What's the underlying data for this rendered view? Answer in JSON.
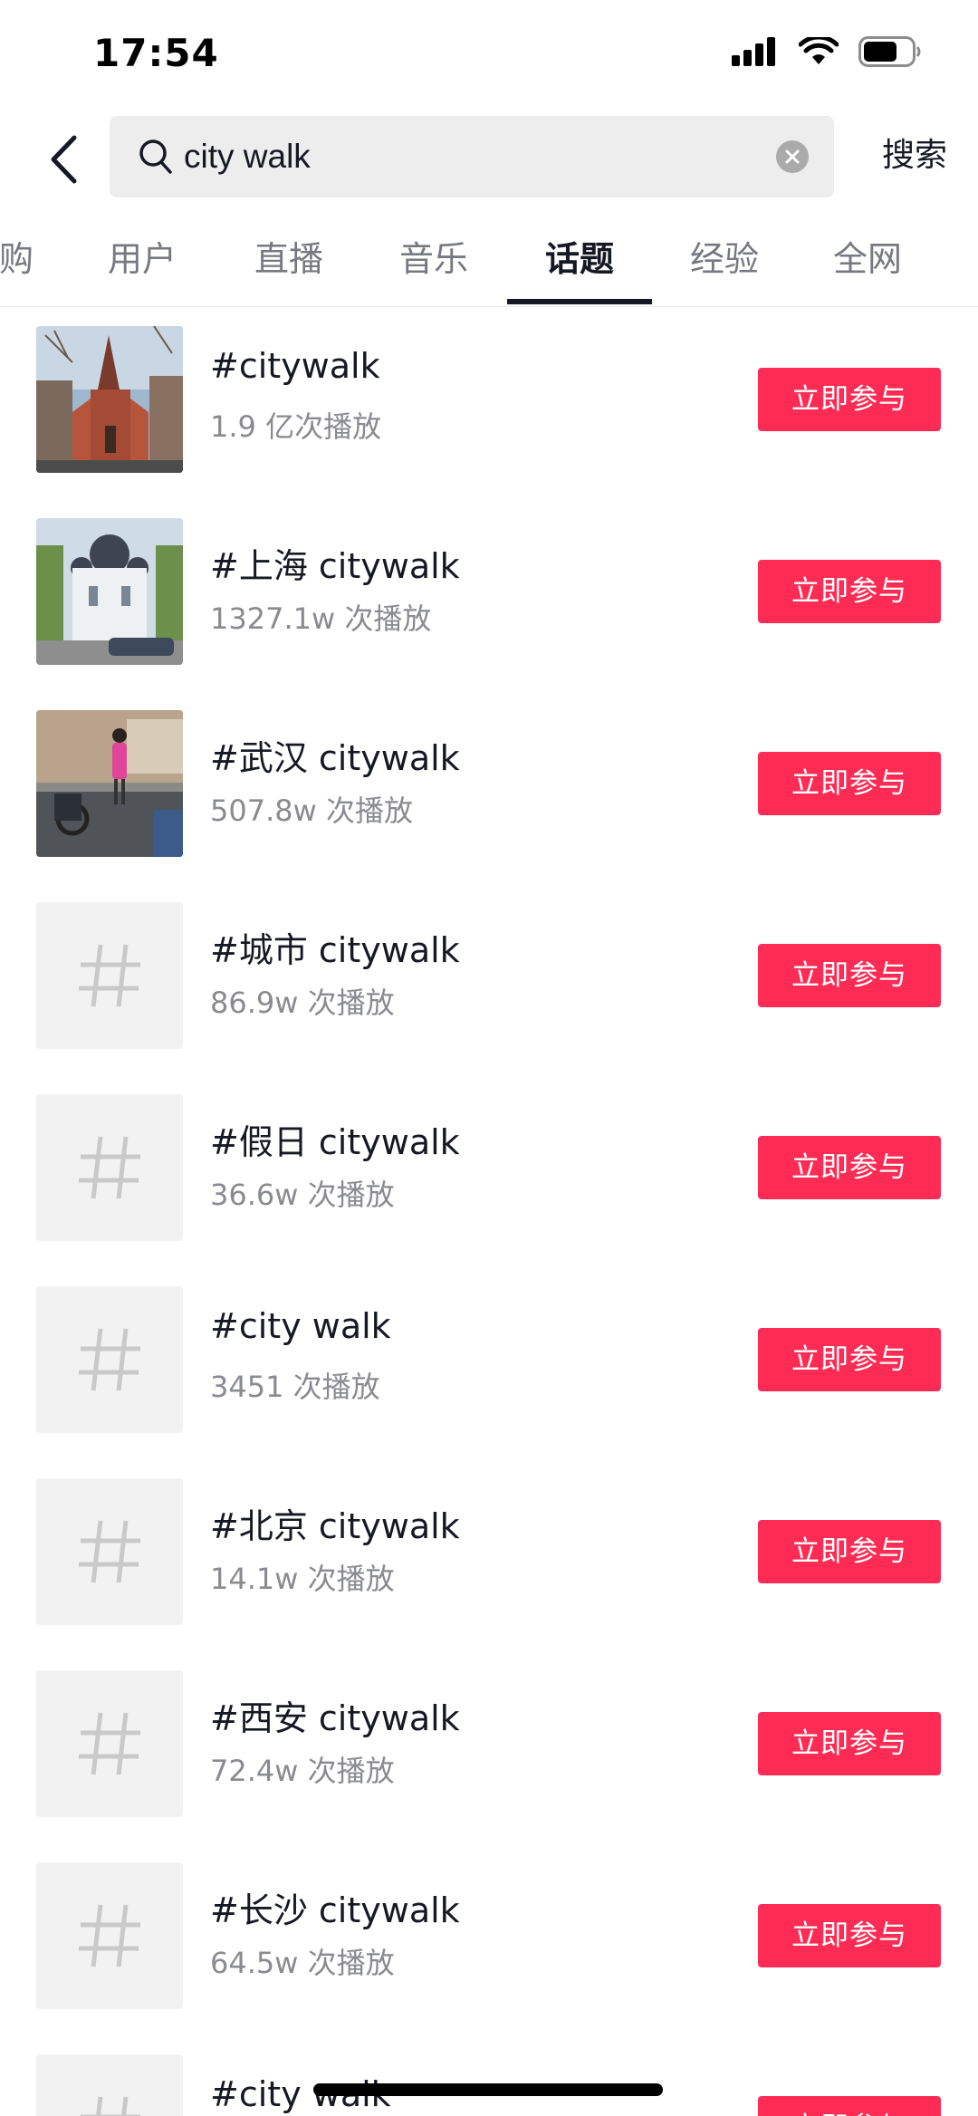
{
  "status_bar": {
    "time": "17:54",
    "icons": [
      "cellular-signal-icon",
      "wifi-icon",
      "battery-icon"
    ]
  },
  "search": {
    "value": "city walk",
    "placeholder": "",
    "submit_label": "搜索"
  },
  "tabs": [
    {
      "label": "购",
      "active": false
    },
    {
      "label": "用户",
      "active": false
    },
    {
      "label": "直播",
      "active": false
    },
    {
      "label": "音乐",
      "active": false
    },
    {
      "label": "话题",
      "active": true
    },
    {
      "label": "经验",
      "active": false
    },
    {
      "label": "全网",
      "active": false
    }
  ],
  "join_label": "立即参与",
  "topics": [
    {
      "title": "#citywalk",
      "plays": "1.9 亿次播放",
      "thumb": "church-photo"
    },
    {
      "title": "#上海 citywalk",
      "plays": "1327.1w 次播放",
      "thumb": "cathedral-photo"
    },
    {
      "title": "#武汉 citywalk",
      "plays": "507.8w 次播放",
      "thumb": "street-photo"
    },
    {
      "title": "#城市 citywalk",
      "plays": "86.9w 次播放",
      "thumb": "hash-icon"
    },
    {
      "title": "#假日 citywalk",
      "plays": "36.6w 次播放",
      "thumb": "hash-icon"
    },
    {
      "title": "#city walk",
      "plays": "3451 次播放",
      "thumb": "hash-icon"
    },
    {
      "title": "#北京 citywalk",
      "plays": "14.1w 次播放",
      "thumb": "hash-icon"
    },
    {
      "title": "#西安 citywalk",
      "plays": "72.4w 次播放",
      "thumb": "hash-icon"
    },
    {
      "title": "#长沙 citywalk",
      "plays": "64.5w 次播放",
      "thumb": "hash-icon"
    },
    {
      "title": "#city walk",
      "plays": "",
      "thumb": "hash-icon"
    }
  ],
  "colors": {
    "accent": "#fe2c55",
    "text_primary": "#161823",
    "text_secondary": "#8a8b91",
    "search_bg": "#ededed"
  }
}
